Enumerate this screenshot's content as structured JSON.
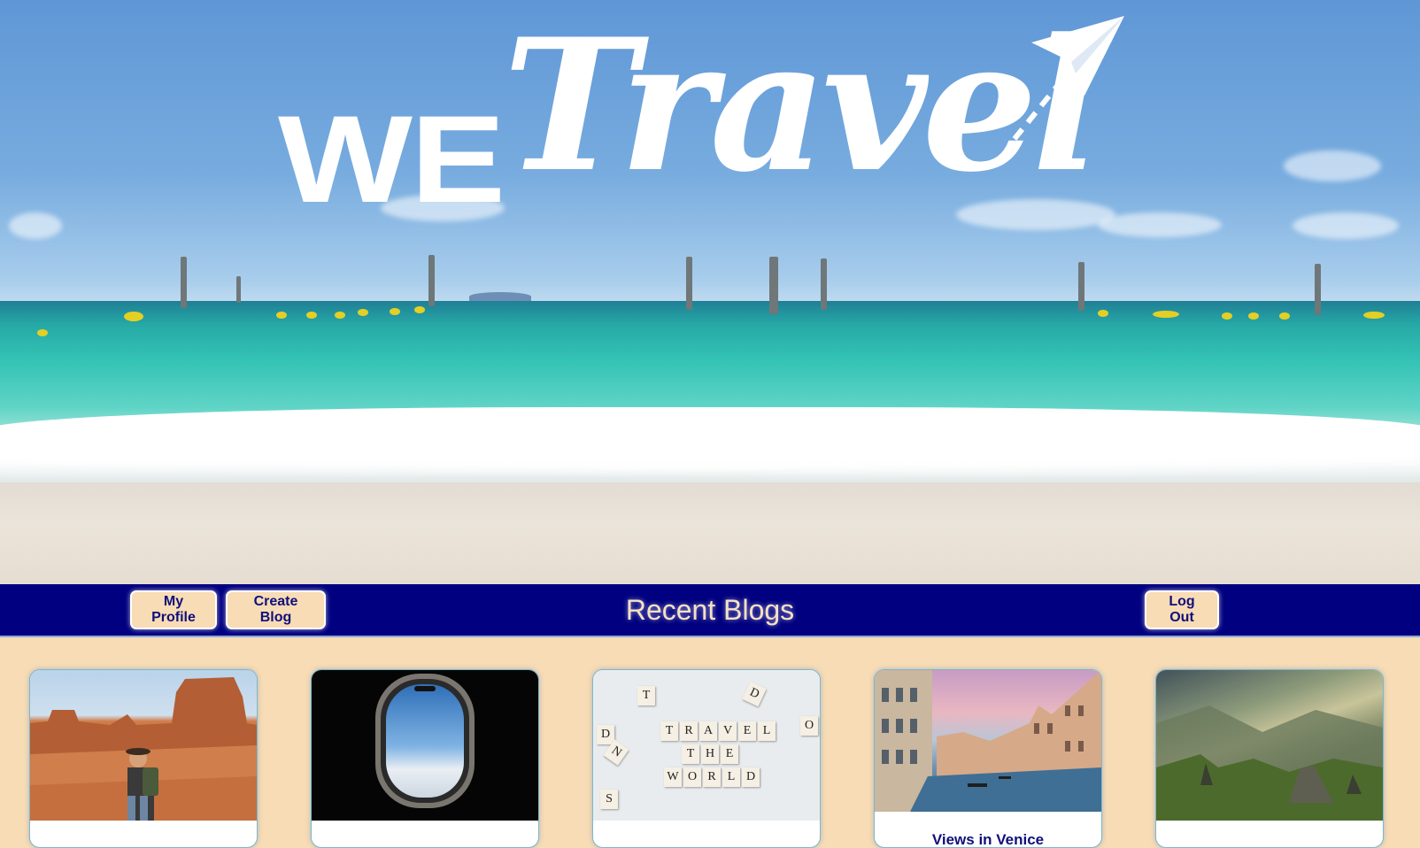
{
  "hero": {
    "logo_we": "WE",
    "logo_travel": "Travel"
  },
  "nav": {
    "my_profile": "My Profile",
    "create_blog": "Create Blog",
    "title": "Recent Blogs",
    "log_out": "Log Out"
  },
  "blogs": [
    {
      "title": ""
    },
    {
      "title": ""
    },
    {
      "title": ""
    },
    {
      "title": "Views in Venice"
    },
    {
      "title": ""
    }
  ],
  "scrabble": {
    "row1": [
      "T",
      "R",
      "A",
      "V",
      "E",
      "L"
    ],
    "row2": [
      "T",
      "H",
      "E"
    ],
    "row3": [
      "W",
      "O",
      "R",
      "L",
      "D"
    ],
    "loose": [
      "T",
      "D",
      "D",
      "N",
      "O",
      "S"
    ]
  },
  "colors": {
    "navbar": "#000080",
    "page_background": "#f8dcb5",
    "button_background": "#f8dcb5",
    "button_text": "#10107a"
  }
}
